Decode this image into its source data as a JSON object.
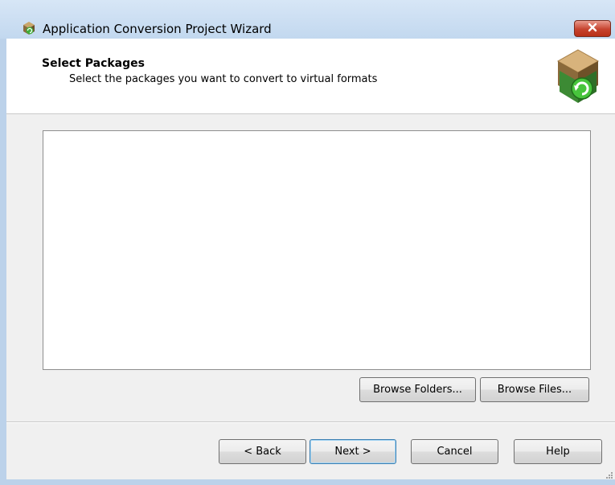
{
  "window": {
    "title": "Application Conversion Project Wizard",
    "icon": "package-convert-icon",
    "close_icon": "close-icon"
  },
  "header": {
    "title": "Select Packages",
    "subtitle": "Select the packages you want to convert to virtual formats",
    "icon": "package-convert-icon"
  },
  "packages": {
    "items": []
  },
  "browse": {
    "folders_label": "Browse Folders...",
    "files_label": "Browse Files..."
  },
  "footer": {
    "back_label": "< Back",
    "next_label": "Next >",
    "cancel_label": "Cancel",
    "help_label": "Help"
  },
  "colors": {
    "titlebar": "#c2d8ef",
    "close_button": "#c6432f",
    "dialog_background": "#f0f0f0",
    "default_button_border": "#3c7fb1"
  }
}
